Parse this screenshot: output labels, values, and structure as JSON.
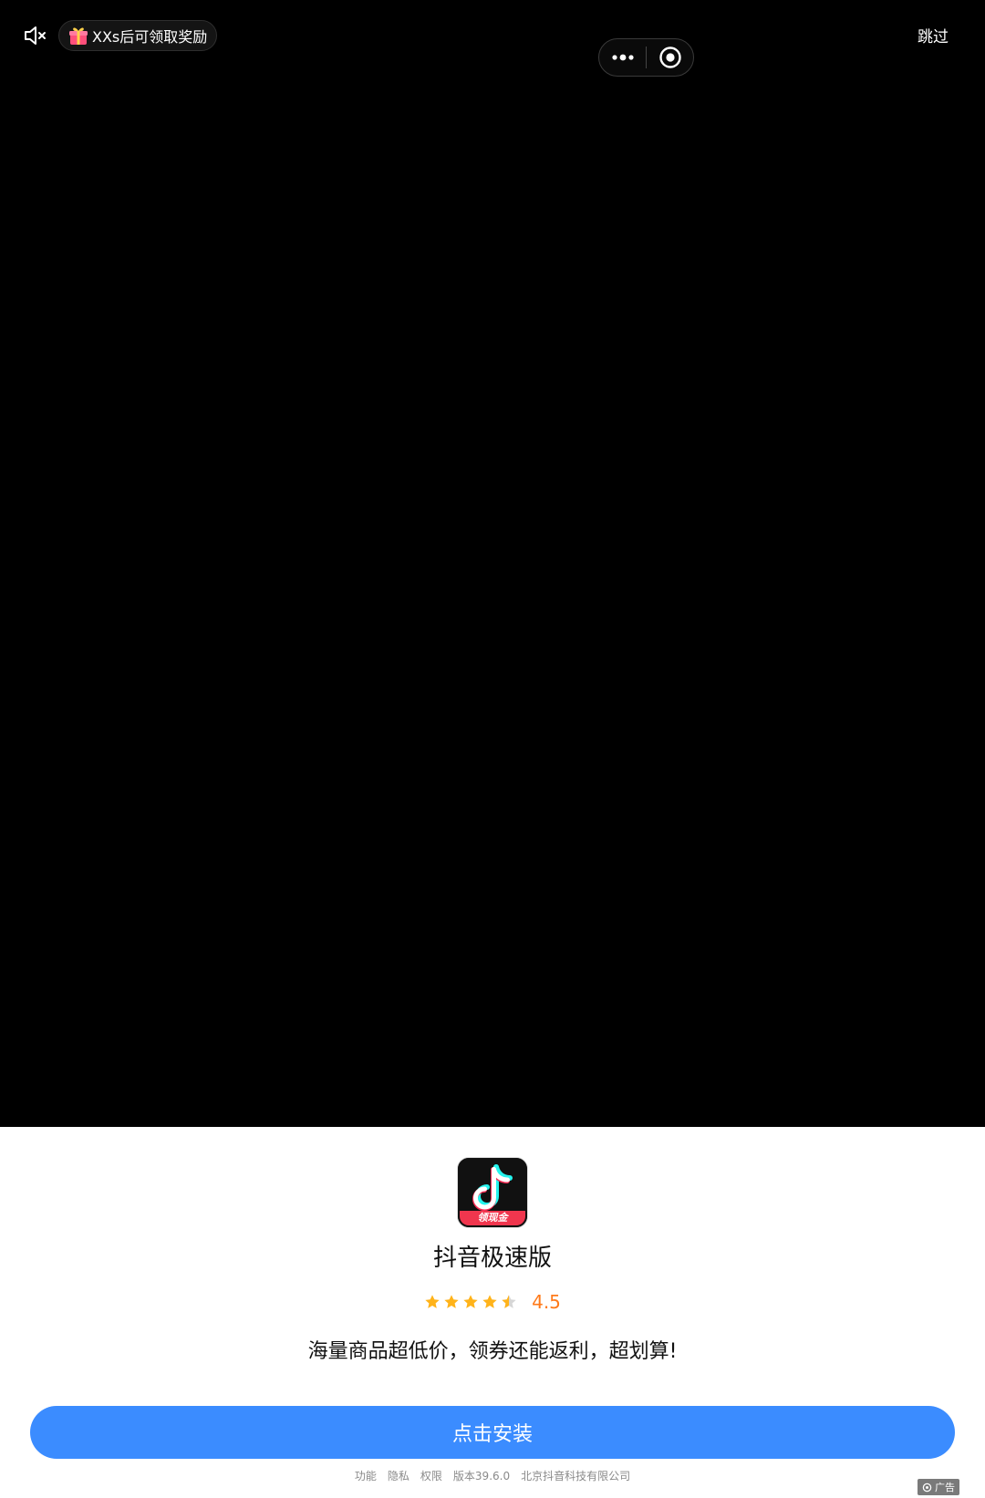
{
  "top_bar": {
    "reward_text": "XXs后可领取奖励",
    "skip_label": "跳过"
  },
  "app": {
    "name": "抖音极速版",
    "icon_badge": "领现金",
    "rating": "4.5",
    "stars_filled": 4.5,
    "description": "海量商品超低价，领券还能返利，超划算!"
  },
  "cta": {
    "install_label": "点击安装"
  },
  "footer": {
    "links": [
      "功能",
      "隐私",
      "权限",
      "版本39.6.0",
      "北京抖音科技有限公司"
    ],
    "ad_label": "广告"
  },
  "colors": {
    "accent_blue": "#3b8cff",
    "rating_orange": "#ff7a1a",
    "star_yellow": "#ffb31a"
  }
}
